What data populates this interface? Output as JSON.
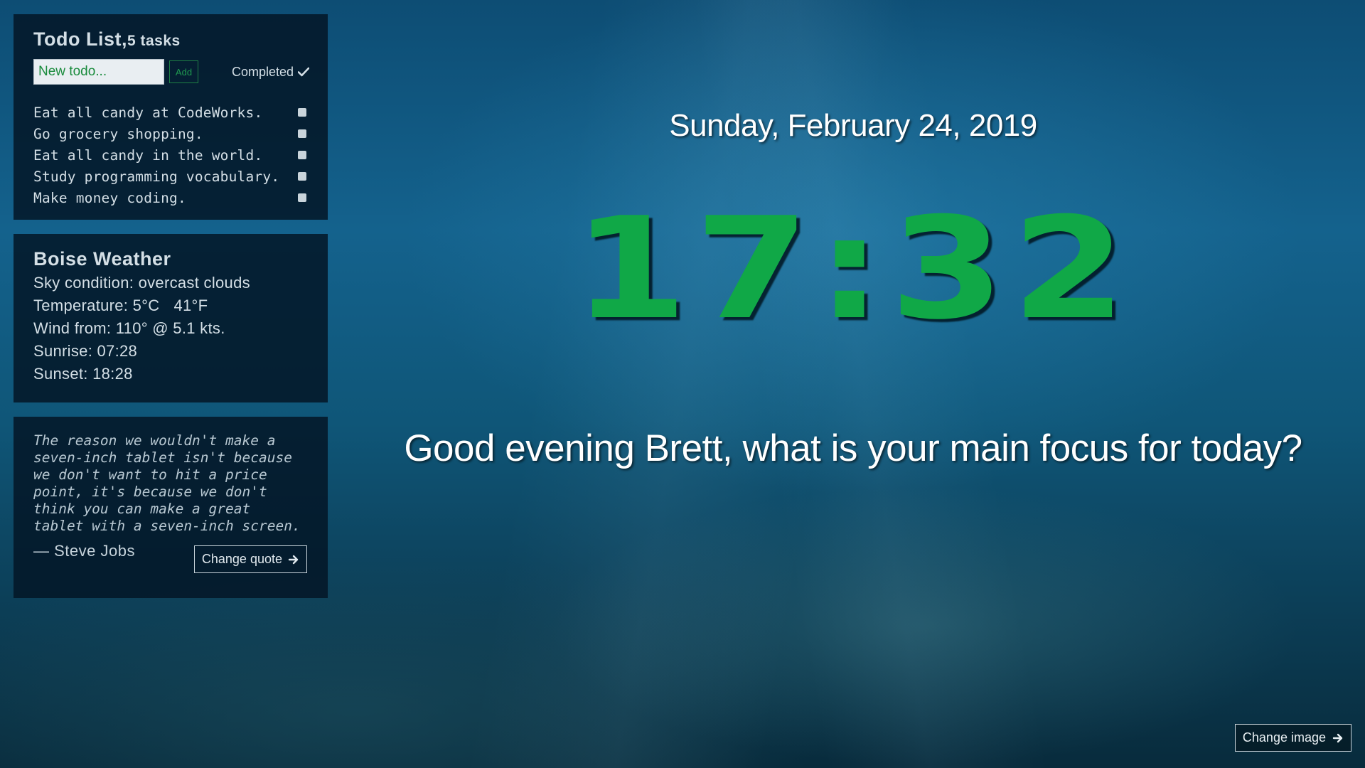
{
  "todo": {
    "title": "Todo List,",
    "count": "5 tasks",
    "input_placeholder": "New todo...",
    "add_label": "Add",
    "completed_label": "Completed",
    "items": [
      "Eat all candy at CodeWorks.",
      "Go grocery shopping.",
      "Eat all candy in the world.",
      "Study programming vocabulary.",
      "Make money coding."
    ]
  },
  "weather": {
    "title": "Boise Weather",
    "sky": "Sky condition: overcast clouds",
    "temperature_c": "Temperature: 5°C",
    "temperature_f": "41°F",
    "wind": "Wind from: 110° @ 5.1 kts.",
    "sunrise": "Sunrise: 07:28",
    "sunset": "Sunset: 18:28"
  },
  "quote": {
    "text": "The reason we wouldn't make a seven-inch tablet isn't because we don't want to hit a price point, it's because we don't think you can make a great tablet with a seven-inch screen.",
    "author": "— Steve Jobs",
    "change_label": "Change quote"
  },
  "main": {
    "date": "Sunday, February 24, 2019",
    "time": "17:32",
    "greeting": "Good evening Brett, what is your main focus for today?"
  },
  "change_image_label": "Change image",
  "colors": {
    "clock": "#10a847",
    "panel": "#041626",
    "accent": "#1a8b3d"
  },
  "icons": {
    "completed": "check-icon",
    "arrow": "arrow-right-icon"
  }
}
